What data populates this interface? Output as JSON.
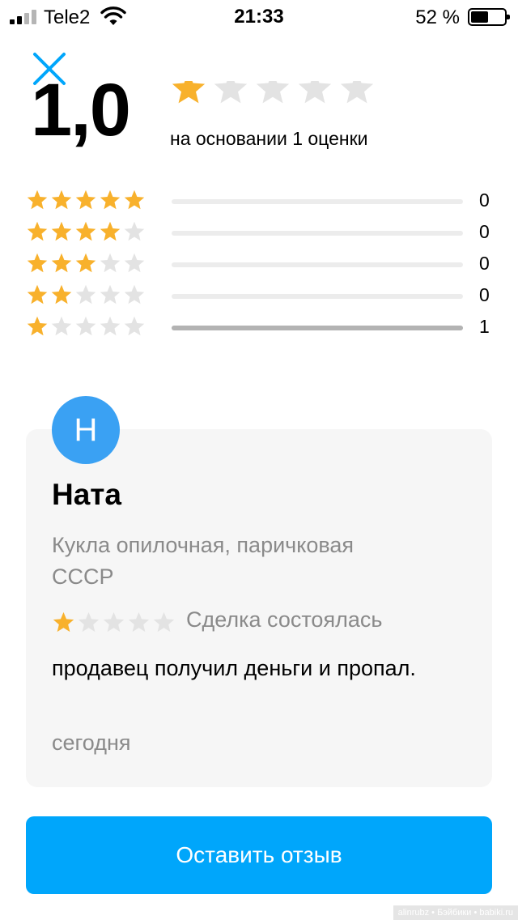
{
  "status_bar": {
    "carrier": "Tele2",
    "time": "21:33",
    "battery_percent": "52 %",
    "battery_level": 0.52
  },
  "icons": {
    "close": "close-icon",
    "star": "star-icon",
    "wifi": "wifi-icon",
    "signal": "signal-icon",
    "battery": "battery-icon"
  },
  "colors": {
    "star_filled": "#f8b12c",
    "star_empty": "#e3e3e3",
    "accent": "#00a6fb",
    "avatar": "#3aa1f3",
    "muted_text": "#8a8a8a"
  },
  "summary": {
    "rating": "1,0",
    "stars_filled": 1,
    "basis_text": "на основании 1 оценки"
  },
  "distribution": [
    {
      "stars": 5,
      "count": "0",
      "share": 0
    },
    {
      "stars": 4,
      "count": "0",
      "share": 0
    },
    {
      "stars": 3,
      "count": "0",
      "share": 0
    },
    {
      "stars": 2,
      "count": "0",
      "share": 0
    },
    {
      "stars": 1,
      "count": "1",
      "share": 1
    }
  ],
  "review": {
    "avatar_letter": "Н",
    "reviewer": "Ната",
    "item_title": "Кукла опилочная, паричковая СССР",
    "stars_filled": 1,
    "deal_status": "Сделка состоялась",
    "text": "продавец получил деньги и пропал.",
    "date": "сегодня"
  },
  "actions": {
    "leave_review_label": "Оставить отзыв"
  },
  "watermark": "alinrubz • Бэйбики • babiki.ru"
}
